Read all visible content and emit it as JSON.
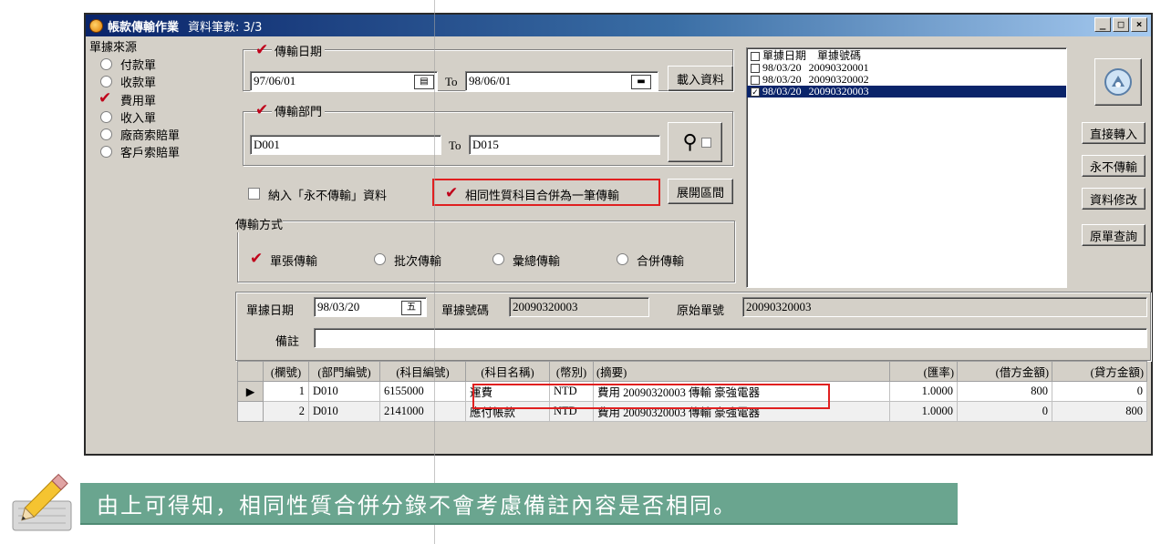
{
  "window": {
    "title": "帳款傳輸作業",
    "record_count": "資料筆數: 3/3",
    "btn_min": "_",
    "btn_max": "□",
    "btn_close": "×"
  },
  "doc_source": {
    "title": "單據來源",
    "options": [
      "付款單",
      "收款單",
      "費用單",
      "收入單",
      "廠商索賠單",
      "客戶索賠單"
    ],
    "selected": "費用單"
  },
  "transfer_date": {
    "label": "傳輸日期",
    "from": "97/06/01",
    "to_label": "To",
    "to": "98/06/01",
    "load_button": "載入資料"
  },
  "transfer_dept": {
    "label": "傳輸部門",
    "from": "D001",
    "to_label": "To",
    "to": "D015"
  },
  "options": {
    "include_never": "納入「永不傳輸」資料",
    "merge_same": "相同性質科目合併為一筆傳輸",
    "expand_interval": "展開區間"
  },
  "transfer_method": {
    "title": "傳輸方式",
    "options": [
      "單張傳輸",
      "批次傳輸",
      "彙總傳輸",
      "合併傳輸"
    ],
    "selected": "單張傳輸"
  },
  "doc_list": {
    "header": [
      "單據日期",
      "單據號碼"
    ],
    "rows": [
      {
        "date": "98/03/20",
        "no": "20090320001",
        "checked": false
      },
      {
        "date": "98/03/20",
        "no": "20090320002",
        "checked": false
      },
      {
        "date": "98/03/20",
        "no": "20090320003",
        "checked": true
      }
    ]
  },
  "side_buttons": [
    "直接轉入",
    "永不傳輸",
    "資料修改",
    "原單查詢"
  ],
  "detail": {
    "doc_date_label": "單據日期",
    "doc_date": "98/03/20",
    "doc_no_label": "單據號碼",
    "doc_no": "20090320003",
    "orig_no_label": "原始單號",
    "orig_no": "20090320003",
    "remark_label": "備註",
    "remark": ""
  },
  "grid": {
    "columns": [
      "(欄號)",
      "(部門編號)",
      "(科目編號)",
      "(科目名稱)",
      "(幣別)",
      "(摘要)",
      "(匯率)",
      "(借方金額)",
      "(貸方金額)"
    ],
    "rows": [
      {
        "indicator": "▶",
        "no": "1",
        "dept": "D010",
        "acct": "6155000",
        "acct_name": "運費",
        "currency": "NTD",
        "summary": "費用 20090320003 傳輸 豪強電器",
        "rate": "1.0000",
        "debit": "800",
        "credit": "0"
      },
      {
        "indicator": "",
        "no": "2",
        "dept": "D010",
        "acct": "2141000",
        "acct_name": "應付帳款",
        "currency": "NTD",
        "summary": "費用 20090320003 傳輸 豪強電器",
        "rate": "1.0000",
        "debit": "0",
        "credit": "800"
      }
    ]
  },
  "note": "由上可得知，相同性質合併分錄不會考慮備註內容是否相同。",
  "colors": {
    "title_bar": "#0a246a",
    "highlight": "#e02020",
    "note_bg": "#6aa58f",
    "face": "#d4d0c8"
  }
}
